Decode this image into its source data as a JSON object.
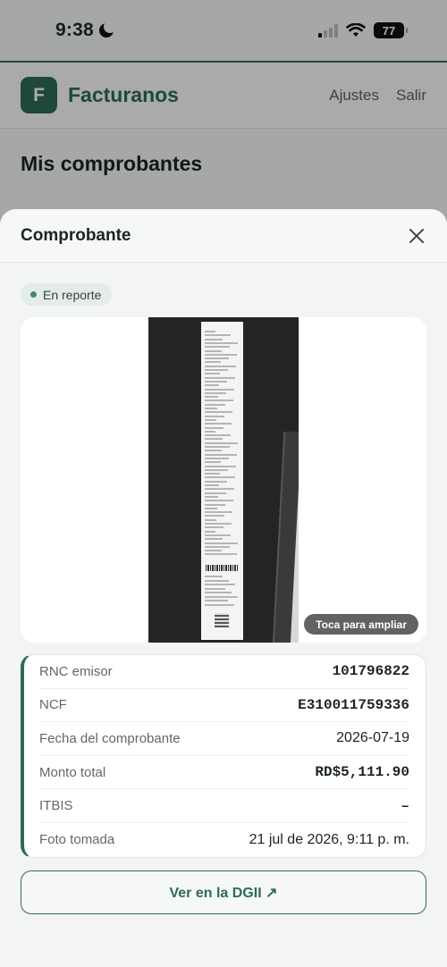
{
  "status_bar": {
    "time": "9:38",
    "battery": "77"
  },
  "app": {
    "logo_letter": "F",
    "brand": "Facturanos",
    "nav": [
      "Ajustes",
      "Salir"
    ],
    "page_title": "Mis comprobantes"
  },
  "sheet": {
    "title": "Comprobante",
    "status_badge": "En reporte",
    "zoom_hint": "Toca para ampliar",
    "details": [
      {
        "label": "RNC emisor",
        "value": "101796822"
      },
      {
        "label": "NCF",
        "value": "E310011759336"
      },
      {
        "label": "Fecha del comprobante",
        "value": "2026-07-19"
      },
      {
        "label": "Monto total",
        "value": "RD$5,111.90"
      },
      {
        "label": "ITBIS",
        "value": "–"
      },
      {
        "label": "Foto tomada",
        "value": "21 jul de 2026, 9:11 p. m."
      }
    ],
    "dgii_button": "Ver en la DGII ↗"
  },
  "colors": {
    "brand": "#2d6b57",
    "badge_dot": "#3f8a6e"
  },
  "icons": {
    "close": "close-icon",
    "moon": "moon-icon"
  }
}
